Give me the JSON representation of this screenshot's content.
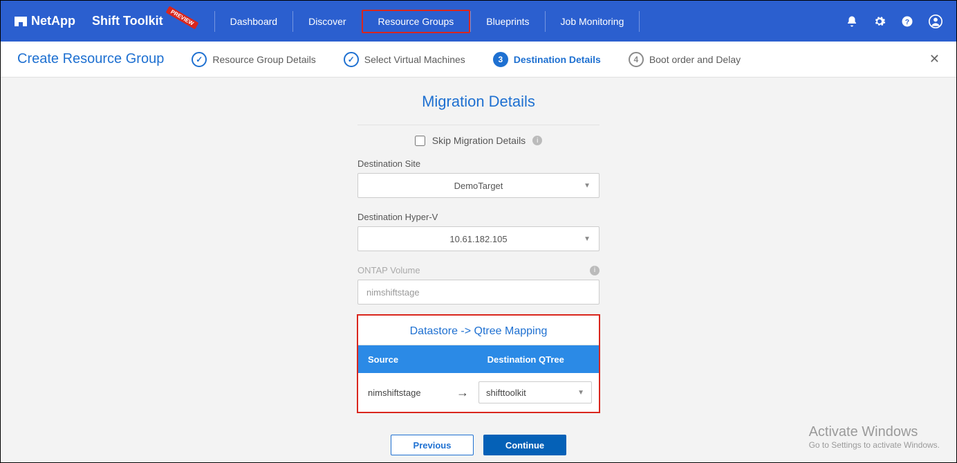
{
  "header": {
    "brand": "NetApp",
    "app_title": "Shift Toolkit",
    "preview_badge": "PREVIEW",
    "nav": [
      "Dashboard",
      "Discover",
      "Resource Groups",
      "Blueprints",
      "Job Monitoring"
    ],
    "highlighted_nav_index": 2
  },
  "wizard": {
    "title": "Create Resource Group",
    "steps": [
      {
        "label": "Resource Group Details",
        "state": "done"
      },
      {
        "label": "Select Virtual Machines",
        "state": "done"
      },
      {
        "label": "Destination Details",
        "state": "active",
        "num": "3"
      },
      {
        "label": "Boot order and Delay",
        "state": "pending",
        "num": "4"
      }
    ]
  },
  "section": {
    "title": "Migration Details",
    "skip_label": "Skip Migration Details",
    "fields": {
      "dest_site_label": "Destination Site",
      "dest_site_value": "DemoTarget",
      "dest_hyperv_label": "Destination Hyper-V",
      "dest_hyperv_value": "10.61.182.105",
      "ontap_label": "ONTAP Volume",
      "ontap_value": "nimshiftstage"
    },
    "mapping": {
      "title": "Datastore -> Qtree Mapping",
      "col_source": "Source",
      "col_dest": "Destination QTree",
      "row_source": "nimshiftstage",
      "row_dest": "shifttoolkit"
    }
  },
  "footer": {
    "previous": "Previous",
    "continue": "Continue"
  },
  "watermark": {
    "line1": "Activate Windows",
    "line2": "Go to Settings to activate Windows."
  }
}
